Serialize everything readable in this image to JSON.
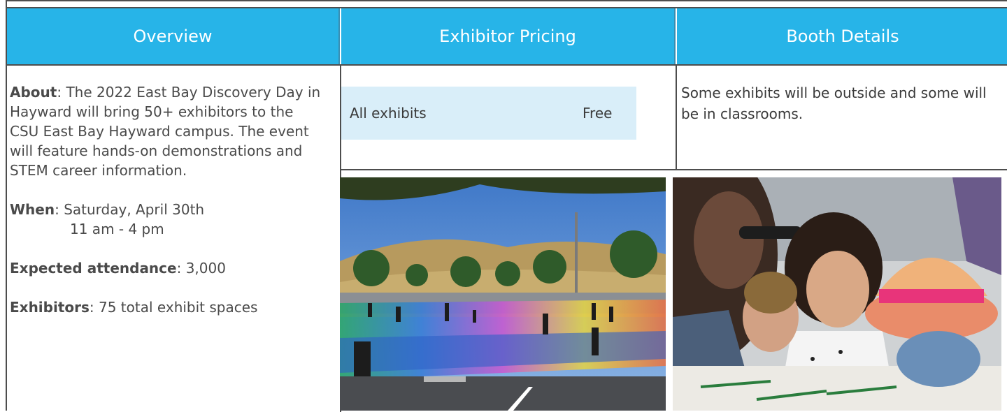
{
  "headers": {
    "overview": "Overview",
    "pricing": "Exhibitor Pricing",
    "booth": "Booth Details"
  },
  "overview": {
    "about_label": "About",
    "about_text": ": The 2022 East Bay Discovery Day in Hayward will bring 50+ exhibitors to the CSU East Bay Hayward campus. The event will feature hands-on demonstrations and STEM career information.",
    "when_label": "When",
    "when_text": ": Saturday, April 30th",
    "when_time": "11 am - 4 pm",
    "attendance_label": "Expected attendance",
    "attendance_text": ": 3,000",
    "exhibitors_label": "Exhibitors",
    "exhibitors_text": ": 75 total exhibit spaces"
  },
  "pricing": {
    "row_label": "All exhibits",
    "row_value": "Free"
  },
  "booth": {
    "text": "Some exhibits will be outside and some will be in classrooms."
  },
  "colors": {
    "header_bg": "#27b4e8",
    "price_bg": "#d9eef9"
  }
}
